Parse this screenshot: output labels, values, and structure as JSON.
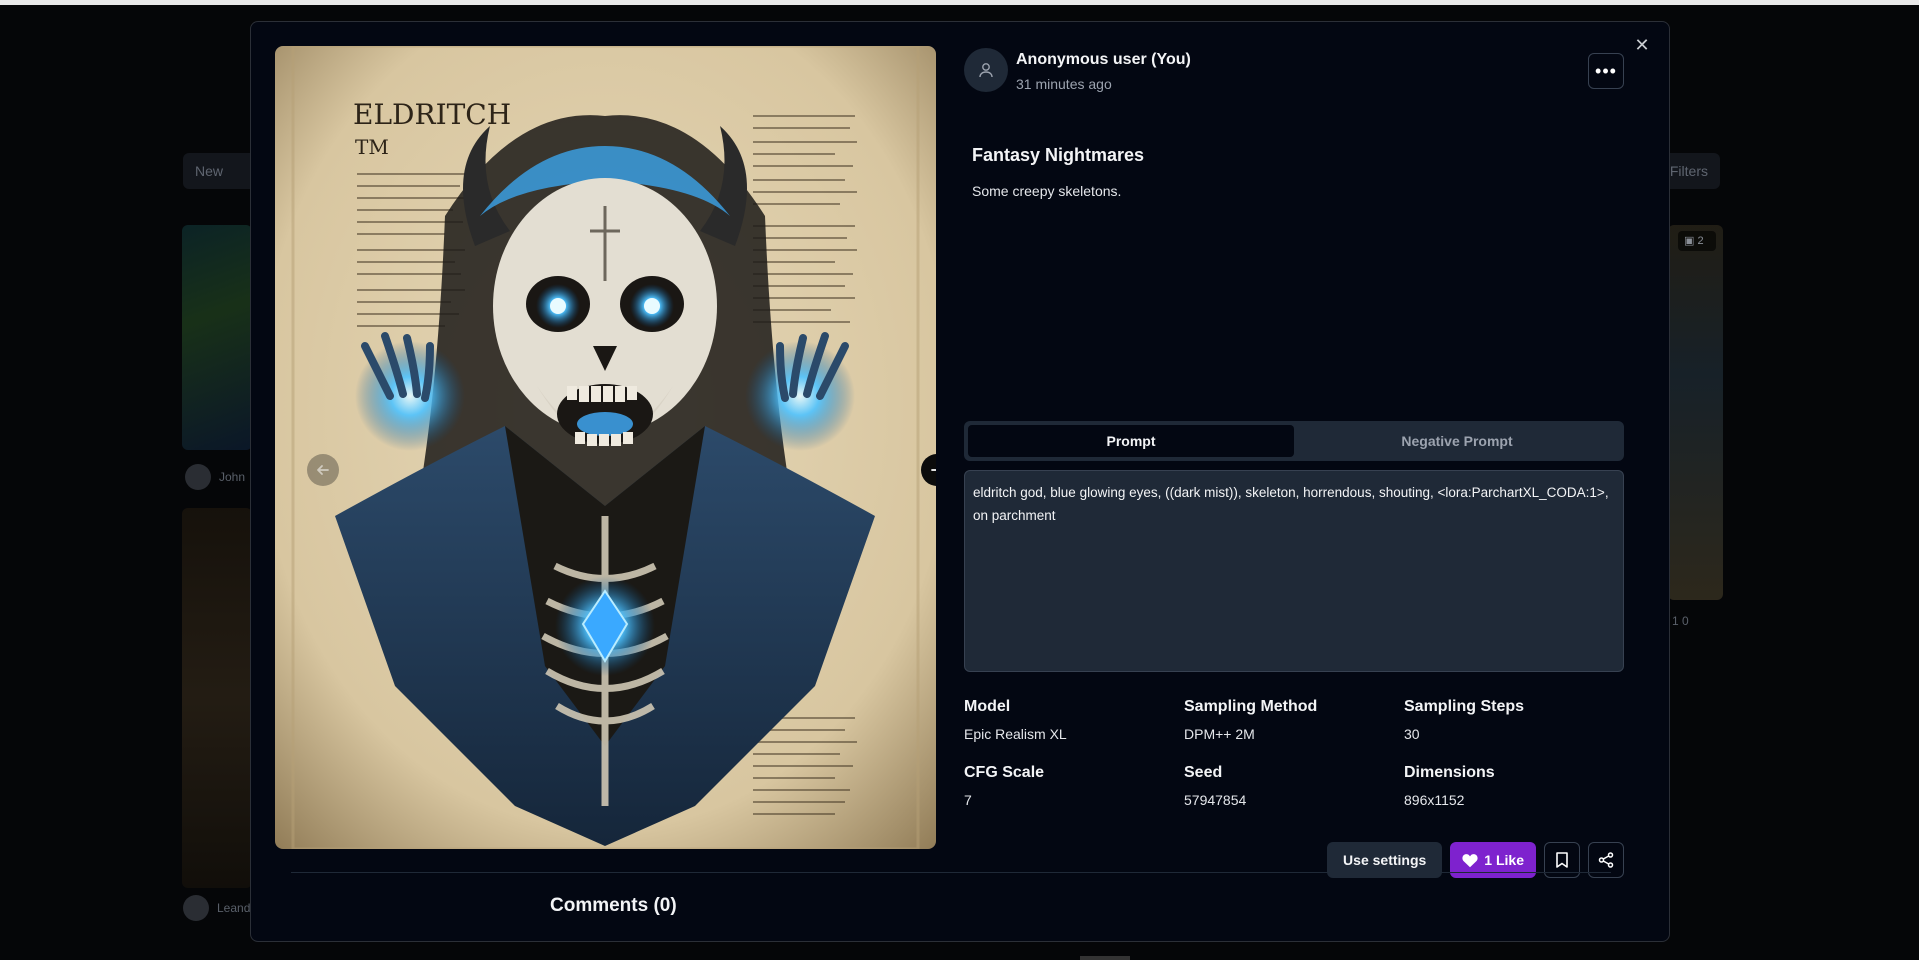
{
  "background": {
    "sort_label": "New",
    "filters_label": "Filters",
    "user1": "John",
    "user2": "Leand",
    "image_count_badge": "2",
    "stats": "1  0"
  },
  "modal": {
    "close_icon": "close-icon",
    "user": {
      "name": "Anonymous user (You)",
      "time": "31 minutes ago",
      "more_icon": "more-horizontal-icon"
    },
    "post": {
      "title": "Fantasy Nightmares",
      "description": "Some creepy skeletons."
    },
    "tabs": [
      {
        "label": "Prompt",
        "active": true
      },
      {
        "label": "Negative Prompt",
        "active": false
      }
    ],
    "prompt_text": "eldritch god, blue glowing eyes, ((dark mist)), skeleton, horrendous, shouting, <lora:ParchartXL_CODA:1>, on parchment",
    "details": [
      {
        "label": "Model",
        "value": "Epic Realism XL"
      },
      {
        "label": "Sampling Method",
        "value": "DPM++ 2M"
      },
      {
        "label": "Sampling Steps",
        "value": "30"
      },
      {
        "label": "CFG Scale",
        "value": "7"
      },
      {
        "label": "Seed",
        "value": "57947854"
      },
      {
        "label": "Dimensions",
        "value": "896x1152"
      }
    ],
    "actions": {
      "use_settings": "Use settings",
      "like_label": "1 Like",
      "bookmark_icon": "bookmark-icon",
      "share_icon": "share-icon"
    },
    "comments_title": "Comments (0)",
    "image_text": {
      "heading": "ELDRITCH",
      "sub": "TM"
    }
  }
}
